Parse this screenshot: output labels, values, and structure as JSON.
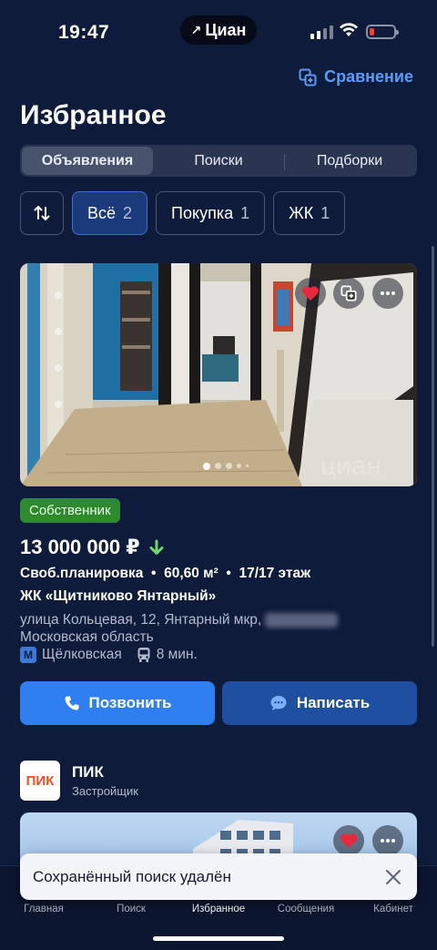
{
  "status": {
    "time": "19:47",
    "carrier_label": "Циан",
    "battery_percent": 12
  },
  "header": {
    "compare_label": "Сравнение",
    "title": "Избранное"
  },
  "segments": [
    {
      "label": "Объявления",
      "active": true
    },
    {
      "label": "Поиски",
      "active": false
    },
    {
      "label": "Подборки",
      "active": false
    }
  ],
  "filters": [
    {
      "label": "Всё",
      "count": "2",
      "active": true
    },
    {
      "label": "Покупка",
      "count": "1",
      "active": false
    },
    {
      "label": "ЖК",
      "count": "1",
      "active": false
    }
  ],
  "listing": {
    "badge": "Собственник",
    "price": "13 000 000 ₽",
    "price_trend": "down",
    "params": "Своб.планировка  •  60,60 м²  •  17/17 этаж",
    "complex": "ЖК «Щитниково Янтарный»",
    "address_line1": "улица Кольцевая, 12, Янтарный мкр,",
    "address_line2": "Московская область",
    "metro_station": "Щёлковская",
    "metro_time": "8 мин.",
    "photo_index": 1,
    "photo_count": 5,
    "favorite": true,
    "call_label": "Позвонить",
    "write_label": "Написать",
    "watermark": "циан"
  },
  "developer": {
    "logo_text": "ПИК",
    "name": "ПИК",
    "role": "Застройщик"
  },
  "toast": {
    "text": "Сохранённый поиск удалён"
  },
  "tabbar": [
    {
      "label": "Главная",
      "active": false
    },
    {
      "label": "Поиск",
      "active": false
    },
    {
      "label": "Избранное",
      "active": true
    },
    {
      "label": "Сообщения",
      "active": false
    },
    {
      "label": "Кабинет",
      "active": false
    }
  ],
  "colors": {
    "background": "#0f1b3a",
    "accent_blue": "#2f7ff0",
    "owner_green": "#2f8a2f",
    "favorite_red": "#e8283c"
  }
}
